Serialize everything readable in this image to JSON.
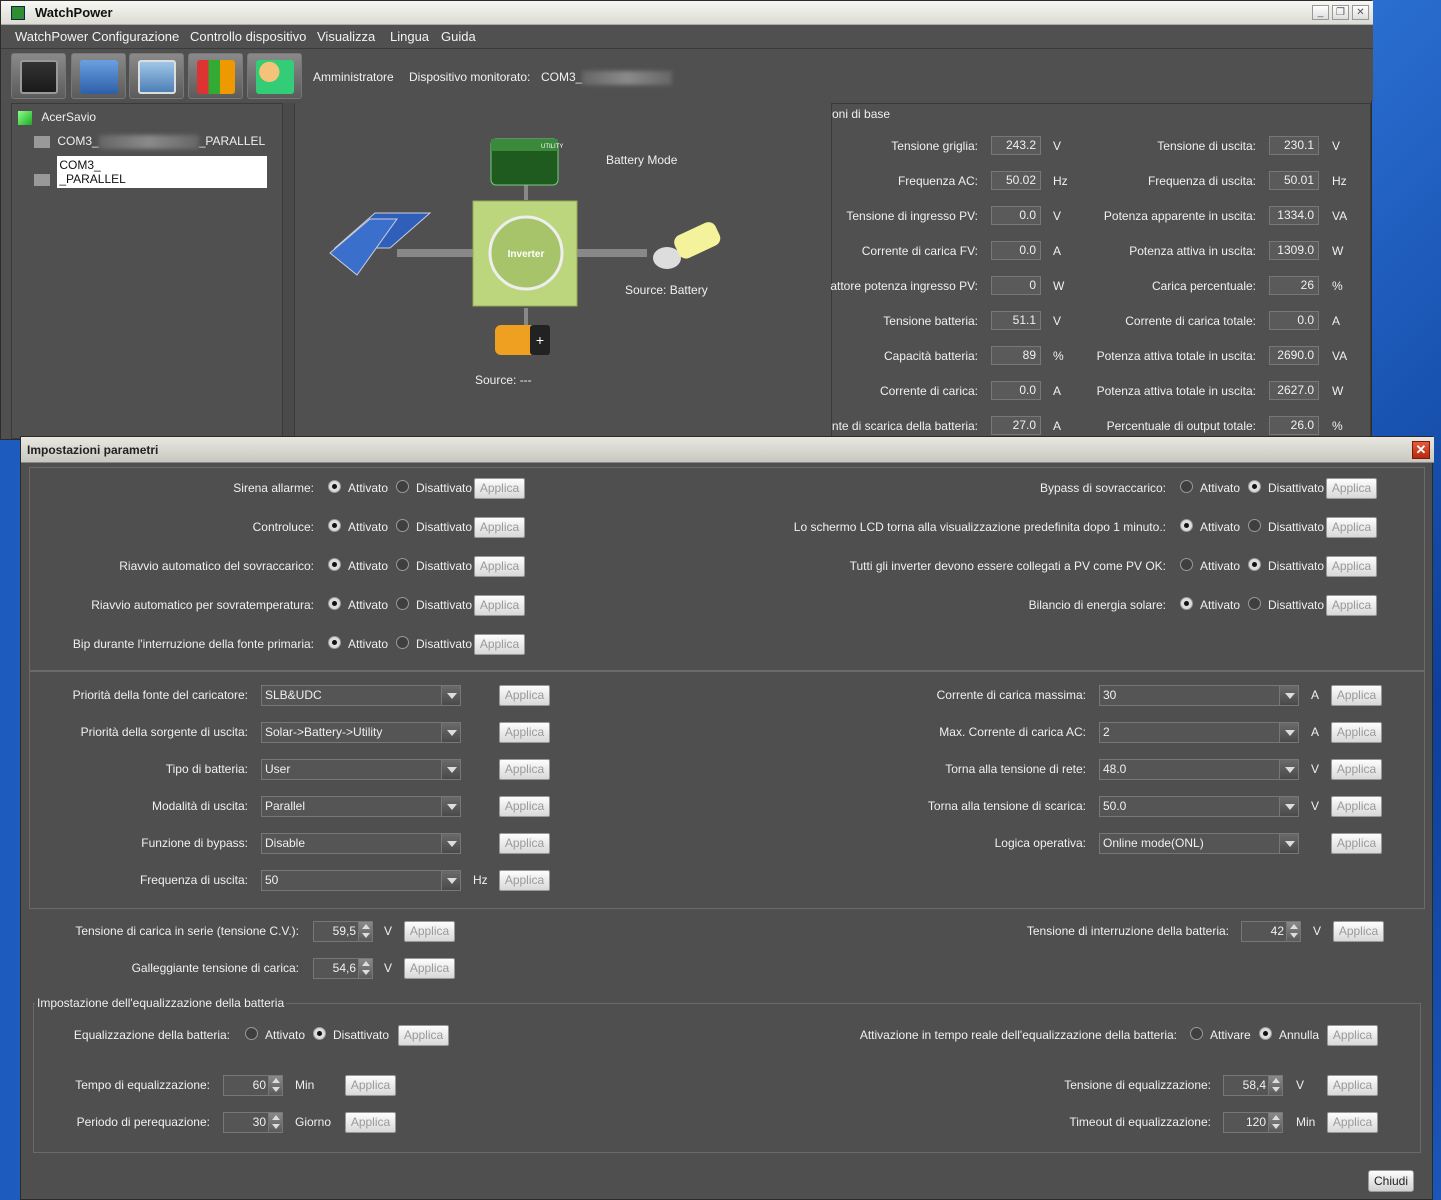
{
  "window": {
    "title": "WatchPower"
  },
  "menu": [
    "WatchPower Configurazione",
    "Controllo dispositivo",
    "Visualizza",
    "Lingua",
    "Guida"
  ],
  "toolbar": {
    "user": "Amministratore",
    "monitored_label": "Dispositivo monitorato:",
    "monitored_value": "COM3_"
  },
  "tree": {
    "root": "AcerSavio",
    "items": [
      {
        "prefix": "COM3_",
        "suffix": "_PARALLEL"
      },
      {
        "prefix": "COM3_",
        "suffix": "_PARALLEL"
      }
    ]
  },
  "diagram": {
    "mode": "Battery Mode",
    "source_right": "Source:  Battery",
    "source_bottom": "Source:  ---",
    "inverter_label": "Inverter",
    "utility_label": "UTILITY"
  },
  "info": {
    "title": "oni di base",
    "left": [
      {
        "label": "Tensione griglia:",
        "value": "243.2",
        "unit": "V"
      },
      {
        "label": "Frequenza AC:",
        "value": "50.02",
        "unit": "Hz"
      },
      {
        "label": "Tensione di ingresso PV:",
        "value": "0.0",
        "unit": "V"
      },
      {
        "label": "Corrente di carica FV:",
        "value": "0.0",
        "unit": "A"
      },
      {
        "label": "attore potenza ingresso PV:",
        "value": "0",
        "unit": "W"
      },
      {
        "label": "Tensione batteria:",
        "value": "51.1",
        "unit": "V"
      },
      {
        "label": "Capacità batteria:",
        "value": "89",
        "unit": "%"
      },
      {
        "label": "Corrente di carica:",
        "value": "0.0",
        "unit": "A"
      },
      {
        "label": "nte di scarica della batteria:",
        "value": "27.0",
        "unit": "A"
      }
    ],
    "right": [
      {
        "label": "Tensione di uscita:",
        "value": "230.1",
        "unit": "V"
      },
      {
        "label": "Frequenza di uscita:",
        "value": "50.01",
        "unit": "Hz"
      },
      {
        "label": "Potenza apparente in uscita:",
        "value": "1334.0",
        "unit": "VA"
      },
      {
        "label": "Potenza attiva in uscita:",
        "value": "1309.0",
        "unit": "W"
      },
      {
        "label": "Carica percentuale:",
        "value": "26",
        "unit": "%"
      },
      {
        "label": "Corrente di carica totale:",
        "value": "0.0",
        "unit": "A"
      },
      {
        "label": "Potenza attiva totale in uscita:",
        "value": "2690.0",
        "unit": "VA"
      },
      {
        "label": "Potenza attiva totale in uscita:",
        "value": "2627.0",
        "unit": "W"
      },
      {
        "label": "Percentuale di output totale:",
        "value": "26.0",
        "unit": "%"
      }
    ]
  },
  "dialog": {
    "title": "Impostazioni parametri",
    "apply": "Applica",
    "on": "Attivato",
    "off": "Disattivato",
    "close": "Chiudi",
    "toggles_left": [
      {
        "label": "Sirena allarme:",
        "state": "on"
      },
      {
        "label": "Controluce:",
        "state": "on"
      },
      {
        "label": "Riavvio automatico del sovraccarico:",
        "state": "on"
      },
      {
        "label": "Riavvio automatico per sovratemperatura:",
        "state": "on"
      },
      {
        "label": "Bip durante l'interruzione della fonte primaria:",
        "state": "on"
      }
    ],
    "toggles_right": [
      {
        "label": "Bypass di sovraccarico:",
        "state": "off"
      },
      {
        "label": "Lo schermo LCD torna alla visualizzazione predefinita dopo 1 minuto.:",
        "state": "on"
      },
      {
        "label": "Tutti gli inverter devono essere collegati a PV come PV OK:",
        "state": "off"
      },
      {
        "label": "Bilancio di energia solare:",
        "state": "on"
      }
    ],
    "combos_left": [
      {
        "label": "Priorità della fonte del caricatore:",
        "value": "SLB&UDC",
        "unit": ""
      },
      {
        "label": "Priorità della sorgente di uscita:",
        "value": "Solar->Battery->Utility",
        "unit": ""
      },
      {
        "label": "Tipo di batteria:",
        "value": "User",
        "unit": ""
      },
      {
        "label": "Modalità di uscita:",
        "value": "Parallel",
        "unit": ""
      },
      {
        "label": "Funzione di bypass:",
        "value": "Disable",
        "unit": ""
      },
      {
        "label": "Frequenza di uscita:",
        "value": "50",
        "unit": "Hz"
      }
    ],
    "combos_right": [
      {
        "label": "Corrente di carica massima:",
        "value": "30",
        "unit": "A"
      },
      {
        "label": "Max. Corrente di carica AC:",
        "value": "2",
        "unit": "A"
      },
      {
        "label": "Torna alla tensione di rete:",
        "value": "48.0",
        "unit": "V"
      },
      {
        "label": "Torna alla tensione di scarica:",
        "value": "50.0",
        "unit": "V"
      },
      {
        "label": "Logica operativa:",
        "value": "Online mode(ONL)",
        "unit": ""
      }
    ],
    "spin_left": [
      {
        "label": "Tensione di carica in serie (tensione C.V.):",
        "value": "59,5",
        "unit": "V"
      },
      {
        "label": "Galleggiante tensione di carica:",
        "value": "54,6",
        "unit": "V"
      }
    ],
    "spin_right": {
      "label": "Tensione di interruzione della batteria:",
      "value": "42",
      "unit": "V"
    },
    "equal": {
      "title": "Impostazione dell'equalizzazione della batteria",
      "eq_label": "Equalizzazione della batteria:",
      "eq_state": "off",
      "rt_label": "Attivazione in tempo reale dell'equalizzazione della batteria:",
      "rt_on": "Attivare",
      "rt_off": "Annulla",
      "rt_state": "off",
      "time": {
        "label": "Tempo di equalizzazione:",
        "value": "60",
        "unit": "Min"
      },
      "period": {
        "label": "Periodo di perequazione:",
        "value": "30",
        "unit": "Giorno"
      },
      "voltage": {
        "label": "Tensione di equalizzazione:",
        "value": "58,4",
        "unit": "V"
      },
      "timeout": {
        "label": "Timeout di equalizzazione:",
        "value": "120",
        "unit": "Min"
      }
    }
  }
}
